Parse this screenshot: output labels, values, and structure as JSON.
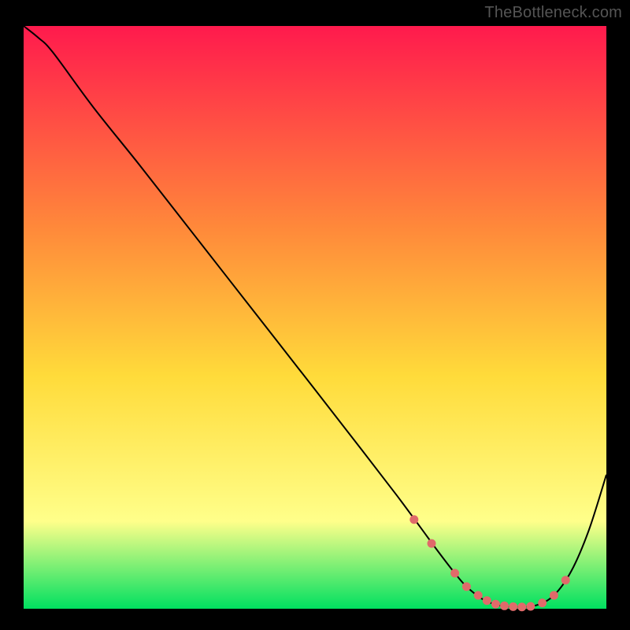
{
  "attribution": "TheBottleneck.com",
  "chart_data": {
    "type": "line",
    "title": "",
    "xlabel": "",
    "ylabel": "",
    "xlim": [
      0,
      100
    ],
    "ylim": [
      0,
      100
    ],
    "background_gradient": {
      "top": "#ff1a4d",
      "mid1": "#ff8a3a",
      "mid2": "#ffdb3a",
      "mid3": "#ffff8a",
      "bottom": "#00e060"
    },
    "series": [
      {
        "name": "bottleneck-curve",
        "color": "#000000",
        "stroke_width": 2,
        "x": [
          0,
          2.5,
          5,
          12,
          20,
          30,
          40,
          50,
          58,
          64,
          68,
          71,
          74,
          76,
          79,
          82,
          85,
          88,
          91,
          94,
          97,
          100
        ],
        "y": [
          100,
          98,
          95.5,
          86,
          76,
          63.2,
          50.4,
          37.6,
          27.3,
          19.5,
          14.1,
          10,
          6.1,
          3.8,
          1.5,
          0.5,
          0.3,
          0.6,
          2.3,
          6.5,
          13.5,
          23
        ]
      }
    ],
    "markers": {
      "name": "sweet-spot-dots",
      "color": "#e06a6a",
      "radius": 5.5,
      "x": [
        67,
        70,
        74,
        76,
        78,
        79.5,
        81,
        82.5,
        84,
        85.5,
        87,
        89,
        91,
        93
      ],
      "y": [
        15.3,
        11.2,
        6.1,
        3.8,
        2.3,
        1.4,
        0.8,
        0.5,
        0.35,
        0.3,
        0.4,
        1.0,
        2.3,
        4.9
      ]
    }
  }
}
